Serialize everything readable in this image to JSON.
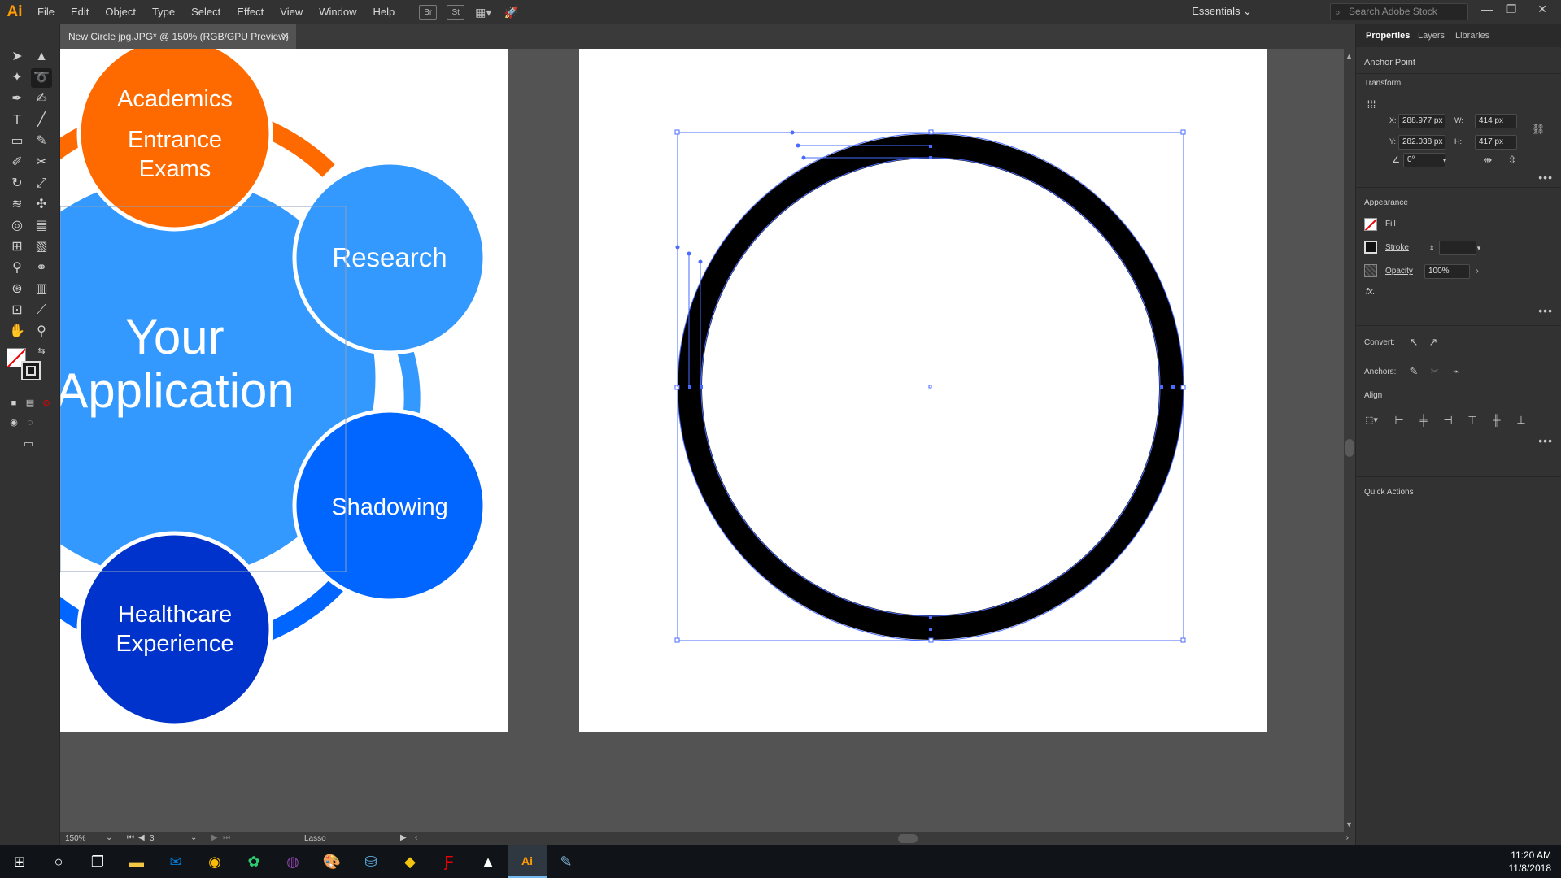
{
  "app": {
    "logo": "Ai"
  },
  "menu": [
    "File",
    "Edit",
    "Object",
    "Type",
    "Select",
    "Effect",
    "View",
    "Window",
    "Help"
  ],
  "menu_icons": {
    "bridge": "Br",
    "stock": "St"
  },
  "workspace": "Essentials",
  "stock_search": {
    "placeholder": "Search Adobe Stock"
  },
  "document_tab": {
    "title": "New Circle jpg.JPG* @ 150% (RGB/GPU Preview)"
  },
  "artwork": {
    "academics": "Academics",
    "entrance": "Entrance",
    "exams": "Exams",
    "research": "Research",
    "your": "Your",
    "application": "Application",
    "shadowing": "Shadowing",
    "healthcare": "Healthcare",
    "experience": "Experience",
    "colors": {
      "orange": "#ff6a00",
      "light_blue": "#3399ff",
      "mid_blue": "#0066ff",
      "dark_blue": "#0033cc"
    }
  },
  "panel": {
    "tabs": [
      "Properties",
      "Layers",
      "Libraries"
    ],
    "selection_type": "Anchor Point",
    "transform_label": "Transform",
    "x_label": "X:",
    "x_value": "288.977 px",
    "y_label": "Y:",
    "y_value": "282.038 px",
    "w_label": "W:",
    "w_value": "414 px",
    "h_label": "H:",
    "h_value": "417 px",
    "angle_value": "0°",
    "appearance_label": "Appearance",
    "fill_label": "Fill",
    "stroke_label": "Stroke",
    "opacity_label": "Opacity",
    "opacity_value": "100%",
    "fx_label": "fx.",
    "convert_label": "Convert:",
    "anchors_label": "Anchors:",
    "align_label": "Align",
    "quick_actions_label": "Quick Actions"
  },
  "status": {
    "zoom": "150%",
    "page": "3",
    "tool": "Lasso"
  },
  "clock": {
    "time": "11:20 AM",
    "date": "11/8/2018"
  }
}
